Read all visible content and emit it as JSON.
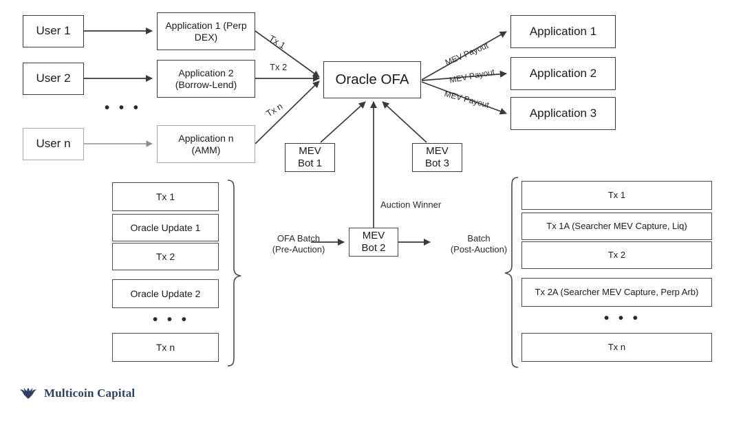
{
  "diagram": {
    "title": "Oracle OFA (Oracle Order Flow Auction) architecture",
    "brand_color": "#2e3d64",
    "line_color": "#3a3a3a",
    "faded_color": "#a8a8a8"
  },
  "users": [
    {
      "label": "User 1"
    },
    {
      "label": "User 2"
    },
    {
      "label": "User n"
    }
  ],
  "users_ellipsis": "• • •",
  "source_apps": [
    {
      "label": "Application 1 (Perp\nDEX)"
    },
    {
      "label": "Application 2\n(Borrow-Lend)"
    },
    {
      "label": "Application n\n(AMM)"
    }
  ],
  "tx_labels": [
    {
      "label": "Tx 1"
    },
    {
      "label": "Tx 2"
    },
    {
      "label": "Tx n"
    }
  ],
  "oracle": {
    "label": "Oracle OFA"
  },
  "mev_bots": [
    {
      "label": "MEV\nBot 1"
    },
    {
      "label": "MEV\nBot 2"
    },
    {
      "label": "MEV\nBot 3"
    }
  ],
  "payout_labels": [
    {
      "label": "MEV Payout"
    },
    {
      "label": "MEV Payout"
    },
    {
      "label": "MEV Payout"
    }
  ],
  "dest_apps": [
    {
      "label": "Application 1"
    },
    {
      "label": "Application 2"
    },
    {
      "label": "Application 3"
    }
  ],
  "pre_auction_batch": {
    "caption": "OFA Batch\n(Pre-Auction)",
    "items": [
      {
        "label": "Tx 1"
      },
      {
        "label": "Oracle Update 1"
      },
      {
        "label": "Tx 2"
      },
      {
        "label": "Oracle Update 2"
      },
      {
        "label": "Tx n"
      }
    ],
    "ellipsis": "• • •"
  },
  "post_auction_batch": {
    "caption": "Batch\n(Post-Auction)",
    "items": [
      {
        "label": "Tx 1"
      },
      {
        "label": "Tx 1A (Searcher MEV Capture, Liq)"
      },
      {
        "label": "Tx 2"
      },
      {
        "label": "Tx 2A (Searcher MEV Capture, Perp Arb)"
      },
      {
        "label": "Tx n"
      }
    ],
    "ellipsis": "• • •"
  },
  "auction_winner_label": "Auction Winner",
  "footer": {
    "wordmark": "Multicoin Capital",
    "icon": "eagle-icon"
  }
}
